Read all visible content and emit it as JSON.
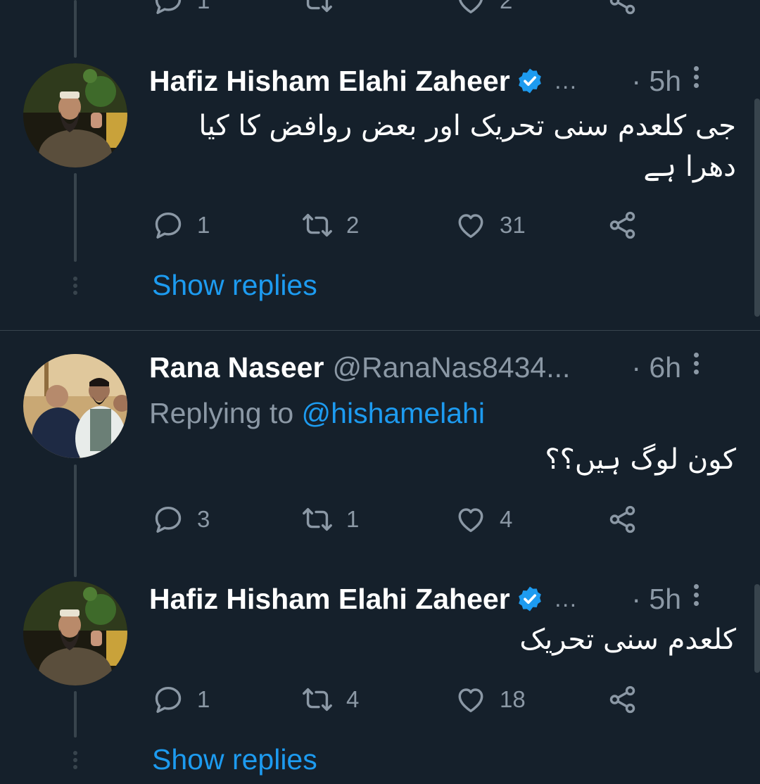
{
  "top_partial": {
    "reply_count": "1",
    "like_count": "2"
  },
  "tweets": [
    {
      "name": "Hafiz Hisham Elahi Zaheer",
      "handle": "…",
      "time": "· 5h",
      "verified": true,
      "text": "جی کلعدم سنی تحریک اور بعض روافض کا کیا دھرا ہے",
      "replies": "1",
      "retweets": "2",
      "likes": "31",
      "show_replies": "Show replies"
    },
    {
      "name": "Rana Naseer",
      "handle": "@RanaNas8434...",
      "time": "· 6h",
      "verified": false,
      "replying_to_label": "Replying to",
      "replying_to_handle": "@hishamelahi",
      "text": "کون لوگ ہیں؟؟",
      "replies": "3",
      "retweets": "1",
      "likes": "4"
    },
    {
      "name": "Hafiz Hisham Elahi Zaheer",
      "handle": "…",
      "time": "· 5h",
      "verified": true,
      "text": "کلعدم سنی تحریک",
      "replies": "1",
      "retweets": "4",
      "likes": "18",
      "show_replies": "Show replies"
    }
  ],
  "icons": {
    "reply": "reply-icon",
    "retweet": "retweet-icon",
    "like": "heart-icon",
    "share": "share-icon",
    "verified": "verified-badge-icon",
    "more": "more-icon"
  },
  "colors": {
    "background": "#15202b",
    "accent": "#1d9bf0",
    "muted": "#8b98a5",
    "line": "#38444d"
  }
}
